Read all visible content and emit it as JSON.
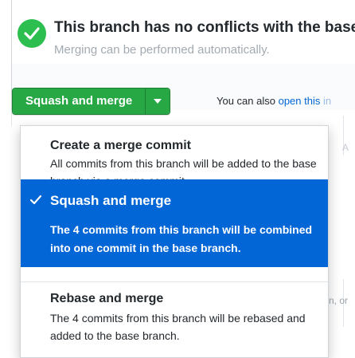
{
  "status": {
    "title": "This branch has no conflicts with the base",
    "subtitle": "Merging can be performed automatically."
  },
  "merge_button": {
    "label": "Squash and merge"
  },
  "also_text": {
    "prefix": "You can also ",
    "link": "open this",
    "faded": " in"
  },
  "menu": {
    "items": [
      {
        "title": "Create a merge commit",
        "description": "All commits from this branch will be added to the base branch via a merge commit.",
        "selected": false
      },
      {
        "title": "Squash and merge",
        "description": "The 4 commits from this branch will be combined into one commit in the base branch.",
        "selected": true
      },
      {
        "title": "Rebase and merge",
        "description": "The 4 commits from this branch will be rebased and added to the base branch.",
        "selected": false
      }
    ]
  },
  "background_fragments": {
    "right_mid": "A",
    "right_bottom": "n, or"
  },
  "colors": {
    "success": "#28a745",
    "check_circle": "#2cbe4e",
    "selected_bg": "#0366d6",
    "link": "#0366d6"
  },
  "icons": {
    "status": "check-circle-icon",
    "caret": "triangle-down-icon",
    "selected": "check-icon"
  }
}
